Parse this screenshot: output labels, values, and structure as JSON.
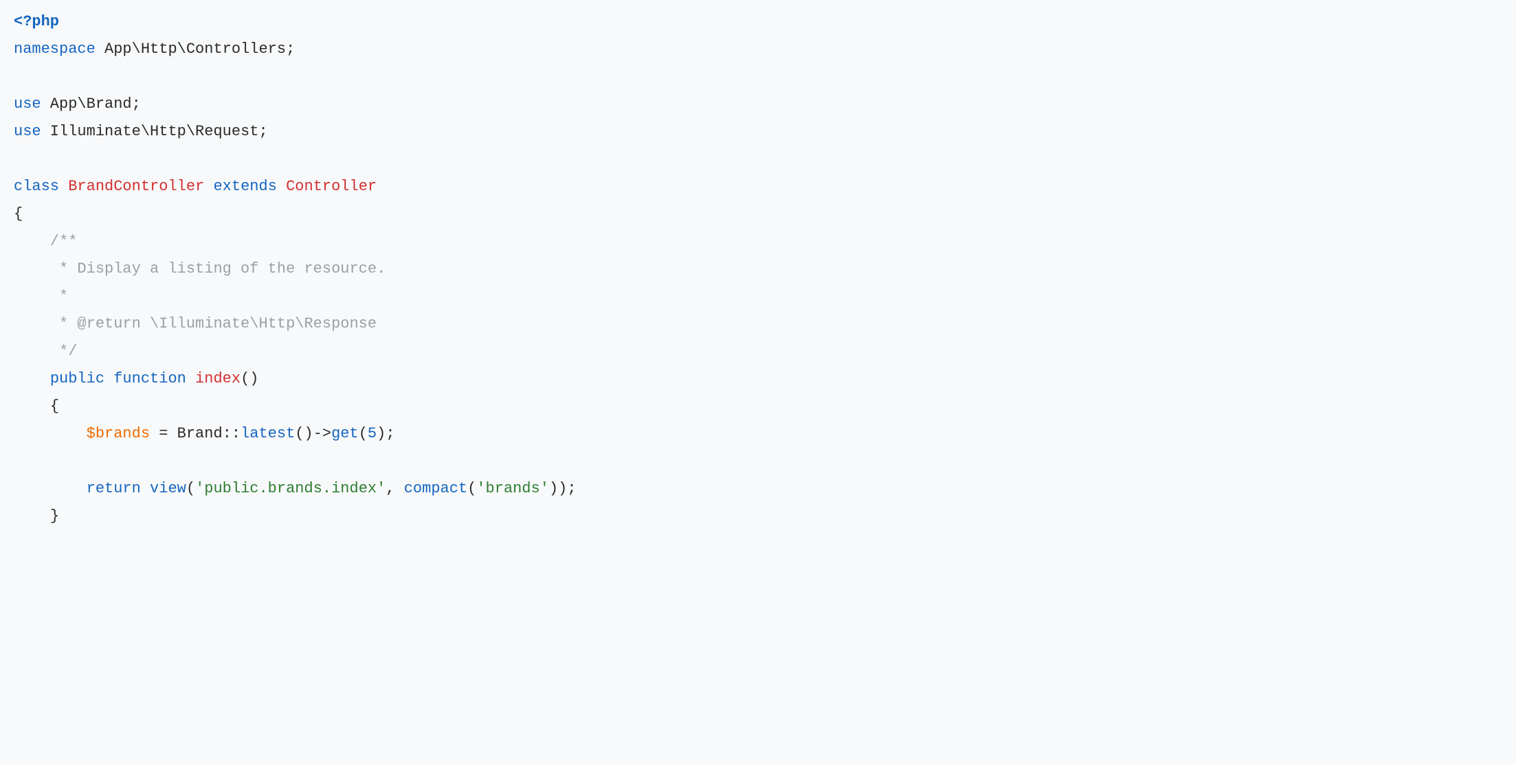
{
  "code": {
    "lines": [
      [
        {
          "cls": "t-open",
          "text": "<?php"
        }
      ],
      [
        {
          "cls": "t-kw",
          "text": "namespace"
        },
        {
          "cls": "t-plain",
          "text": " App\\Http\\Controllers;"
        }
      ],
      [],
      [
        {
          "cls": "t-kw",
          "text": "use"
        },
        {
          "cls": "t-plain",
          "text": " App\\Brand;"
        }
      ],
      [
        {
          "cls": "t-kw",
          "text": "use"
        },
        {
          "cls": "t-plain",
          "text": " Illuminate\\Http\\Request;"
        }
      ],
      [],
      [
        {
          "cls": "t-kw",
          "text": "class"
        },
        {
          "cls": "t-plain",
          "text": " "
        },
        {
          "cls": "t-type",
          "text": "BrandController"
        },
        {
          "cls": "t-plain",
          "text": " "
        },
        {
          "cls": "t-kw",
          "text": "extends"
        },
        {
          "cls": "t-plain",
          "text": " "
        },
        {
          "cls": "t-type",
          "text": "Controller"
        }
      ],
      [
        {
          "cls": "t-punc",
          "text": "{"
        }
      ],
      [
        {
          "cls": "t-comment",
          "text": "    /**"
        }
      ],
      [
        {
          "cls": "t-comment",
          "text": "     * Display a listing of the resource."
        }
      ],
      [
        {
          "cls": "t-comment",
          "text": "     *"
        }
      ],
      [
        {
          "cls": "t-comment",
          "text": "     * @return \\Illuminate\\Http\\Response"
        }
      ],
      [
        {
          "cls": "t-comment",
          "text": "     */"
        }
      ],
      [
        {
          "cls": "t-plain",
          "text": "    "
        },
        {
          "cls": "t-kw",
          "text": "public"
        },
        {
          "cls": "t-plain",
          "text": " "
        },
        {
          "cls": "t-kw",
          "text": "function"
        },
        {
          "cls": "t-plain",
          "text": " "
        },
        {
          "cls": "t-fn",
          "text": "index"
        },
        {
          "cls": "t-punc",
          "text": "()"
        }
      ],
      [
        {
          "cls": "t-plain",
          "text": "    "
        },
        {
          "cls": "t-punc",
          "text": "{"
        }
      ],
      [
        {
          "cls": "t-plain",
          "text": "        "
        },
        {
          "cls": "t-var",
          "text": "$brands"
        },
        {
          "cls": "t-plain",
          "text": " = Brand::"
        },
        {
          "cls": "t-call",
          "text": "latest"
        },
        {
          "cls": "t-punc",
          "text": "()->"
        },
        {
          "cls": "t-call",
          "text": "get"
        },
        {
          "cls": "t-punc",
          "text": "("
        },
        {
          "cls": "t-num",
          "text": "5"
        },
        {
          "cls": "t-punc",
          "text": ");"
        }
      ],
      [],
      [
        {
          "cls": "t-plain",
          "text": "        "
        },
        {
          "cls": "t-kw",
          "text": "return"
        },
        {
          "cls": "t-plain",
          "text": " "
        },
        {
          "cls": "t-call",
          "text": "view"
        },
        {
          "cls": "t-punc",
          "text": "("
        },
        {
          "cls": "t-str",
          "text": "'public.brands.index'"
        },
        {
          "cls": "t-punc",
          "text": ", "
        },
        {
          "cls": "t-call",
          "text": "compact"
        },
        {
          "cls": "t-punc",
          "text": "("
        },
        {
          "cls": "t-str",
          "text": "'brands'"
        },
        {
          "cls": "t-punc",
          "text": "));"
        }
      ],
      [
        {
          "cls": "t-plain",
          "text": "    "
        },
        {
          "cls": "t-punc",
          "text": "}"
        }
      ]
    ]
  }
}
